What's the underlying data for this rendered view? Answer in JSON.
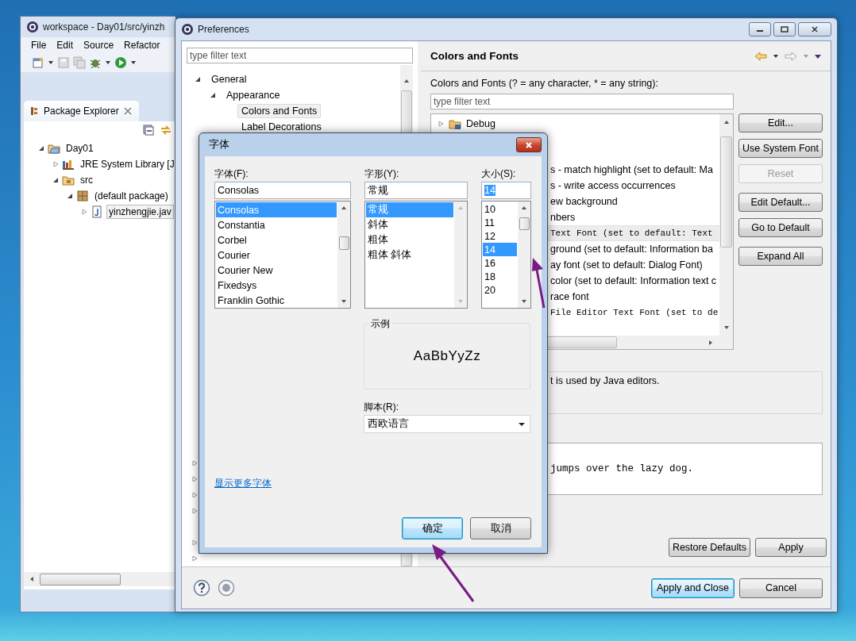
{
  "eclipse_window": {
    "title": "workspace - Day01/src/yinzh",
    "menu": [
      "File",
      "Edit",
      "Source",
      "Refactor"
    ],
    "view_tab": {
      "label": "Package Explorer"
    },
    "tree": [
      {
        "label": "Day01",
        "kind": "project",
        "expanded": true,
        "selected": false,
        "children": [
          {
            "label": "JRE System Library [J",
            "kind": "library",
            "expanded": false,
            "selected": false
          },
          {
            "label": "src",
            "kind": "source",
            "expanded": true,
            "selected": false,
            "children": [
              {
                "label": "(default package)",
                "kind": "package",
                "expanded": true,
                "selected": false,
                "children": [
                  {
                    "label": "yinzhengjie.jav",
                    "kind": "file",
                    "expanded": false,
                    "selected": true
                  }
                ]
              }
            ]
          }
        ]
      }
    ]
  },
  "preferences": {
    "title": "Preferences",
    "filter": {
      "placeholder": "type filter text"
    },
    "tree": [
      {
        "label": "General",
        "expanded": true,
        "selected": false,
        "children": [
          {
            "label": "Appearance",
            "expanded": true,
            "selected": false,
            "children": [
              {
                "label": "Colors and Fonts",
                "selected": true
              },
              {
                "label": "Label Decorations",
                "selected": false
              }
            ]
          }
        ]
      }
    ],
    "page": {
      "title": "Colors and Fonts",
      "filter_label": "Colors and Fonts (? = any character, * = any string):",
      "filter": {
        "placeholder": "type filter text"
      },
      "category": {
        "label": "Debug",
        "expanded": false
      },
      "items": [
        {
          "text": "s - match highlight (set to default: Ma",
          "kind": "label",
          "selected": false
        },
        {
          "text": "s - write access occurrences",
          "kind": "label",
          "selected": false
        },
        {
          "text": "ew background",
          "kind": "label",
          "selected": false
        },
        {
          "text": "nbers",
          "kind": "label",
          "selected": false
        },
        {
          "text": "Text Font (set to default: Text",
          "kind": "monospace",
          "selected": true
        },
        {
          "text": "ground (set to default: Information ba",
          "kind": "label",
          "selected": false
        },
        {
          "text": "ay font (set to default: Dialog Font)",
          "kind": "label",
          "selected": false
        },
        {
          "text": "color (set to default: Information text c",
          "kind": "label",
          "selected": false
        },
        {
          "text": "race font",
          "kind": "label",
          "selected": false
        },
        {
          "text": "File Editor Text Font (set to de",
          "kind": "monospace",
          "selected": false
        }
      ],
      "button_groups": [
        [
          {
            "label": "Edit...",
            "disabled": false
          },
          {
            "label": "Use System Font",
            "disabled": false
          },
          {
            "label": "Reset",
            "disabled": true
          }
        ],
        [
          {
            "label": "Edit Default...",
            "disabled": false
          },
          {
            "label": "Go to Default",
            "disabled": false
          }
        ],
        [
          {
            "label": "Expand All",
            "disabled": false
          }
        ]
      ],
      "description": "t is used by Java editors.",
      "preview": "jumps over the lazy dog.",
      "page_buttons": [
        "Restore Defaults",
        "Apply"
      ]
    },
    "footer_buttons": [
      {
        "label": "Apply and Close",
        "default": true
      },
      {
        "label": "Cancel",
        "default": false
      }
    ]
  },
  "font_dialog": {
    "title": "字体",
    "font": {
      "label": "字体(F):",
      "value": "Consolas",
      "value_selected": false,
      "options": [
        {
          "label": "Consolas",
          "selected": true
        },
        {
          "label": "Constantia",
          "selected": false
        },
        {
          "label": "Corbel",
          "selected": false
        },
        {
          "label": "Courier",
          "selected": false
        },
        {
          "label": "Courier New",
          "selected": false
        },
        {
          "label": "Fixedsys",
          "selected": false
        },
        {
          "label": "Franklin Gothic",
          "selected": false
        }
      ]
    },
    "style": {
      "label": "字形(Y):",
      "value": "常规",
      "value_selected": false,
      "options": [
        {
          "label": "常规",
          "selected": true
        },
        {
          "label": "斜体",
          "selected": false
        },
        {
          "label": "粗体",
          "selected": false
        },
        {
          "label": "粗体 斜体",
          "selected": false
        }
      ]
    },
    "size": {
      "label": "大小(S):",
      "value": "14",
      "value_selected": true,
      "options": [
        {
          "label": "10",
          "selected": false
        },
        {
          "label": "11",
          "selected": false
        },
        {
          "label": "12",
          "selected": false
        },
        {
          "label": "14",
          "selected": true
        },
        {
          "label": "16",
          "selected": false
        },
        {
          "label": "18",
          "selected": false
        },
        {
          "label": "20",
          "selected": false
        }
      ]
    },
    "sample": {
      "label": "示例",
      "text": "AaBbYyZz"
    },
    "script": {
      "label": "脚本(R):",
      "value": "西欧语言"
    },
    "more_fonts_link": "显示更多字体",
    "buttons": [
      {
        "label": "确定",
        "default": true
      },
      {
        "label": "取消",
        "default": false
      }
    ]
  }
}
